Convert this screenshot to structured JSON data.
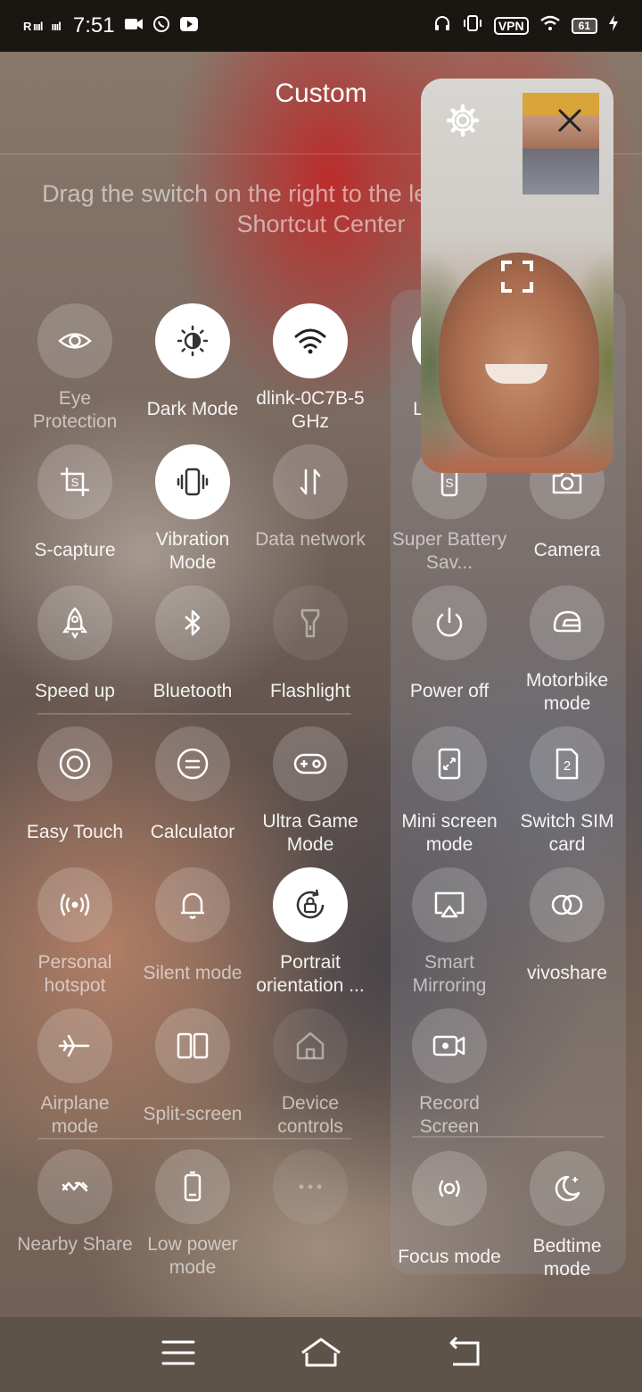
{
  "status_bar": {
    "signal_1": "R ıııl",
    "signal_2": "ıııl",
    "time": "7:51",
    "vpn": "VPN",
    "battery": "61"
  },
  "header": {
    "title": "Custom",
    "hint": "Drag the switch on the right to the left to add it to the Shortcut Center"
  },
  "left_tiles": [
    {
      "label": "Eye Protection",
      "icon": "eye-icon",
      "state": "off"
    },
    {
      "label": "Dark Mode",
      "icon": "dark-mode-icon",
      "state": "on"
    },
    {
      "label": "dlink-0C7B-5 GHz",
      "icon": "wifi-icon",
      "state": "on"
    },
    {
      "label": "S-capture",
      "icon": "screenshot-icon",
      "state": "off"
    },
    {
      "label": "Vibration Mode",
      "icon": "vibration-icon",
      "state": "on"
    },
    {
      "label": "Data network",
      "icon": "data-arrows-icon",
      "state": "off"
    },
    {
      "label": "Speed up",
      "icon": "rocket-icon",
      "state": "off"
    },
    {
      "label": "Bluetooth",
      "icon": "bluetooth-icon",
      "state": "off"
    },
    {
      "label": "Flashlight",
      "icon": "flashlight-icon",
      "state": "disabled"
    },
    {
      "label": "Easy Touch",
      "icon": "easy-touch-icon",
      "state": "off"
    },
    {
      "label": "Calculator",
      "icon": "calculator-icon",
      "state": "off"
    },
    {
      "label": "Ultra Game Mode",
      "icon": "gamepad-icon",
      "state": "off"
    },
    {
      "label": "Personal hotspot",
      "icon": "hotspot-icon",
      "state": "off"
    },
    {
      "label": "Silent mode",
      "icon": "bell-icon",
      "state": "off"
    },
    {
      "label": "Portrait orientation ...",
      "icon": "rotation-lock-icon",
      "state": "on"
    },
    {
      "label": "Airplane mode",
      "icon": "airplane-icon",
      "state": "off"
    },
    {
      "label": "Split-screen",
      "icon": "split-screen-icon",
      "state": "off"
    },
    {
      "label": "Device controls",
      "icon": "home-icon",
      "state": "disabled"
    },
    {
      "label": "Nearby Share",
      "icon": "nearby-share-icon",
      "state": "off"
    },
    {
      "label": "Low power mode",
      "icon": "battery-icon",
      "state": "off"
    },
    {
      "label": "",
      "icon": "more-dots-icon",
      "state": "disabled"
    }
  ],
  "right_tiles": [
    {
      "label": "Super Battery Sav...",
      "icon": "super-battery-icon"
    },
    {
      "label": "Camera",
      "icon": "camera-icon"
    },
    {
      "label": "Power off",
      "icon": "power-icon"
    },
    {
      "label": "Motorbike mode",
      "icon": "helmet-icon"
    },
    {
      "label": "Mini screen mode",
      "icon": "mini-screen-icon"
    },
    {
      "label": "Switch SIM card",
      "icon": "sim-card-icon"
    },
    {
      "label": "Smart Mirroring",
      "icon": "mirroring-icon"
    },
    {
      "label": "vivoshare",
      "icon": "vivoshare-icon"
    },
    {
      "label": "Record Screen",
      "icon": "record-screen-icon"
    },
    {
      "label": "Focus mode",
      "icon": "focus-icon"
    },
    {
      "label": "Bedtime mode",
      "icon": "moon-icon"
    }
  ],
  "right_hidden_labels": {
    "partial_label": "L"
  }
}
